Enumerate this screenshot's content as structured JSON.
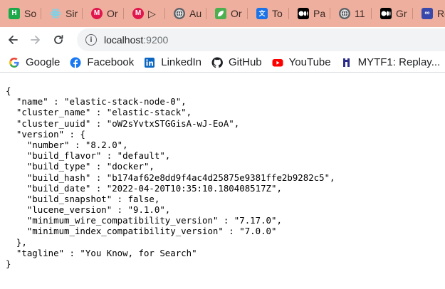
{
  "tabs": [
    {
      "title": "So",
      "icon": "hackerrank-icon",
      "color": "#1ba94c"
    },
    {
      "title": "Sir",
      "icon": "react-icon",
      "color": "#61dafb"
    },
    {
      "title": "Or",
      "icon": "m-logo-icon",
      "color": "#e0174d"
    },
    {
      "title": "▷",
      "icon": "m-logo-icon",
      "color": "#e0174d"
    },
    {
      "title": "Au",
      "icon": "globe-icon",
      "color": "#5f6368"
    },
    {
      "title": "Or",
      "icon": "leaf-icon",
      "color": "#4caf50"
    },
    {
      "title": "To",
      "icon": "translate-icon",
      "color": "#1a73e8"
    },
    {
      "title": "Pa",
      "icon": "medium-icon",
      "color": "#000000"
    },
    {
      "title": "11",
      "icon": "globe-icon",
      "color": "#5f6368"
    },
    {
      "title": "Gr",
      "icon": "medium-icon",
      "color": "#000000"
    },
    {
      "title": "Re",
      "icon": "infinity-icon",
      "color": "#3949ab"
    }
  ],
  "toolbar": {
    "url_host": "localhost",
    "url_port": ":9200"
  },
  "bookmarks": [
    {
      "label": "Google",
      "icon": "google-icon"
    },
    {
      "label": "Facebook",
      "icon": "facebook-icon"
    },
    {
      "label": "LinkedIn",
      "icon": "linkedin-icon"
    },
    {
      "label": "GitHub",
      "icon": "github-icon"
    },
    {
      "label": "YouTube",
      "icon": "youtube-icon"
    },
    {
      "label": "MYTF1: Replay...",
      "icon": "mytf1-icon"
    }
  ],
  "json_lines": [
    "{",
    "  \"name\" : \"elastic-stack-node-0\",",
    "  \"cluster_name\" : \"elastic-stack\",",
    "  \"cluster_uuid\" : \"oW2sYvtxSTGGisA-wJ-EoA\",",
    "  \"version\" : {",
    "    \"number\" : \"8.2.0\",",
    "    \"build_flavor\" : \"default\",",
    "    \"build_type\" : \"docker\",",
    "    \"build_hash\" : \"b174af62e8dd9f4ac4d25875e9381ffe2b9282c5\",",
    "    \"build_date\" : \"2022-04-20T10:35:10.180408517Z\",",
    "    \"build_snapshot\" : false,",
    "    \"lucene_version\" : \"9.1.0\",",
    "    \"minimum_wire_compatibility_version\" : \"7.17.0\",",
    "    \"minimum_index_compatibility_version\" : \"7.0.0\"",
    "  },",
    "  \"tagline\" : \"You Know, for Search\"",
    "}"
  ]
}
